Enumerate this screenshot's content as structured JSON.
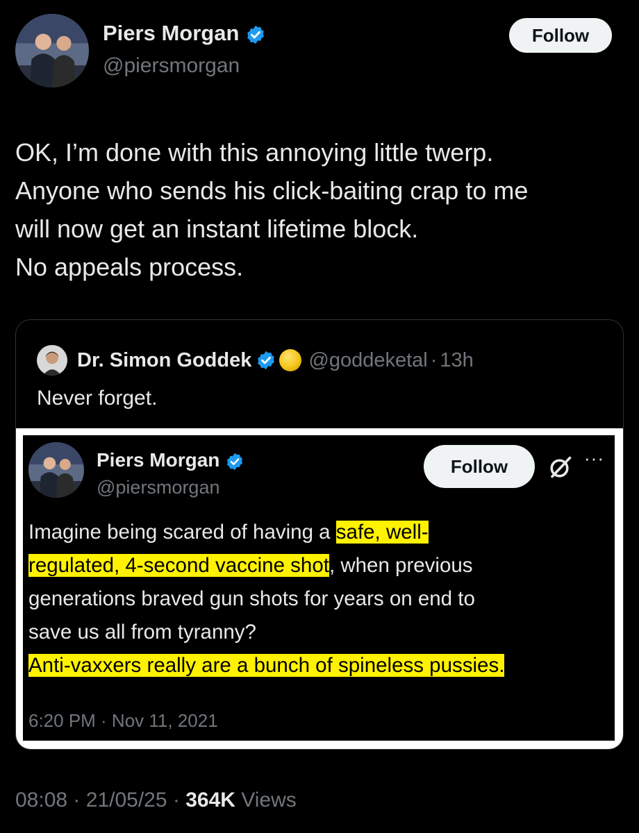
{
  "tweet": {
    "author_name": "Piers Morgan",
    "author_handle": "@piersmorgan",
    "follow_label": "Follow",
    "text_lines": [
      "OK, I’m done with this annoying little twerp.",
      "Anyone who sends his click-baiting crap to me",
      "will now get an instant lifetime block.",
      "No appeals process."
    ],
    "time": "08:08",
    "date": "21/05/25",
    "views_count": "364K",
    "views_label": "Views",
    "separator": "·"
  },
  "quote": {
    "author_name": "Dr. Simon Goddek",
    "author_handle": "@goddeketal",
    "age": "13h",
    "text": "Never forget.",
    "emoji_icon": "yellow-circle-emoji"
  },
  "embedded_tweet": {
    "author_name": "Piers Morgan",
    "author_handle": "@piersmorgan",
    "follow_label": "Follow",
    "line1_plain": "Imagine being scared of having a ",
    "line1_highlight": "safe, well-",
    "line2_highlight": "regulated, 4-second vaccine shot",
    "line2_plain": ", when previous",
    "line3": "generations braved gun shots for years on end to",
    "line4": "save us all from tyranny?",
    "line5_highlight": "Anti-vaxxers really are a bunch of spineless pussies.",
    "timestamp": "6:20 PM · Nov 11, 2021",
    "highlight_color": "#fff200"
  },
  "colors": {
    "background": "#000000",
    "text_primary": "#e7e9ea",
    "text_secondary": "#71767b",
    "verified_blue": "#1d9bf0",
    "card_border": "#2f3336"
  }
}
